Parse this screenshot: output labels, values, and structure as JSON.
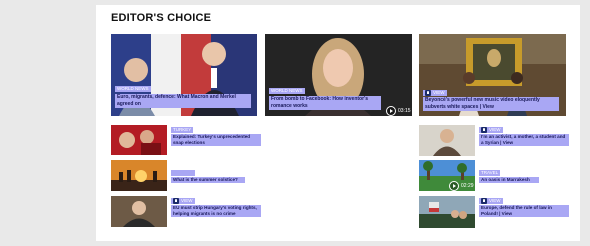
{
  "section": {
    "title": "EDITOR'S CHOICE"
  },
  "featured": [
    {
      "tag": "WORLD NEWS",
      "title": "Euro, migrants, defence: What Macron and Merkel agreed on"
    },
    {
      "tag": "WORLD NEWS",
      "title": "From bomb to Facebook: How inventor's romance works",
      "duration": "03:15"
    },
    {
      "tag": "VIEW",
      "title": "Beyoncé's powerful new music video eloquently subverts white spaces | View"
    }
  ],
  "left_list": [
    {
      "tag": "TURKEY",
      "title": "Explained: Turkey's unprecedented snap elections"
    },
    {
      "tag": "",
      "title": "What is the summer solstice?"
    },
    {
      "tag": "VIEW",
      "title": "EU must strip Hungary's voting rights, helping migrants is no crime"
    }
  ],
  "right_list": [
    {
      "tag": "VIEW",
      "title": "I'm an activist, a mother, a student and a Syrian | View"
    },
    {
      "tag": "TRAVEL",
      "title": "An oasis in Marrakesh",
      "duration": "02:29"
    },
    {
      "tag": "VIEW",
      "title": "Europe, defend the rule of law in Poland! | View"
    }
  ]
}
